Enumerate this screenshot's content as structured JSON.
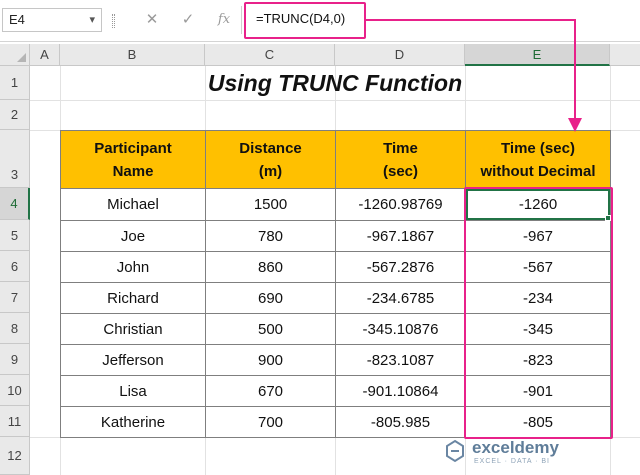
{
  "formula_bar": {
    "name_box": "E4",
    "cancel_symbol": "✕",
    "enter_symbol": "✓",
    "fx_symbol": "fx",
    "formula": "=TRUNC(D4,0)"
  },
  "grid": {
    "columns": [
      "A",
      "B",
      "C",
      "D",
      "E"
    ],
    "selected_column": "E",
    "rows": [
      "1",
      "2",
      "3",
      "4",
      "5",
      "6",
      "7",
      "8",
      "9",
      "10",
      "11",
      "12"
    ],
    "selected_row": "4"
  },
  "sheet_title": "Using TRUNC Function",
  "table": {
    "headers": [
      [
        "Participant",
        "Name"
      ],
      [
        "Distance",
        "(m)"
      ],
      [
        "Time",
        "(sec)"
      ],
      [
        "Time (sec)",
        "without Decimal"
      ]
    ],
    "rows": [
      [
        "Michael",
        "1500",
        "-1260.98769",
        "-1260"
      ],
      [
        "Joe",
        "780",
        "-967.1867",
        "-967"
      ],
      [
        "John",
        "860",
        "-567.2876",
        "-567"
      ],
      [
        "Richard",
        "690",
        "-234.6785",
        "-234"
      ],
      [
        "Christian",
        "500",
        "-345.10876",
        "-345"
      ],
      [
        "Jefferson",
        "900",
        "-823.1087",
        "-823"
      ],
      [
        "Lisa",
        "670",
        "-901.10864",
        "-901"
      ],
      [
        "Katherine",
        "700",
        "-805.985",
        "-805"
      ]
    ]
  },
  "watermark": {
    "brand": "exceldemy",
    "tagline": "EXCEL · DATA · BI"
  },
  "colors": {
    "header_fill": "#ffc000",
    "highlight": "#e8218a",
    "selection": "#217346"
  }
}
